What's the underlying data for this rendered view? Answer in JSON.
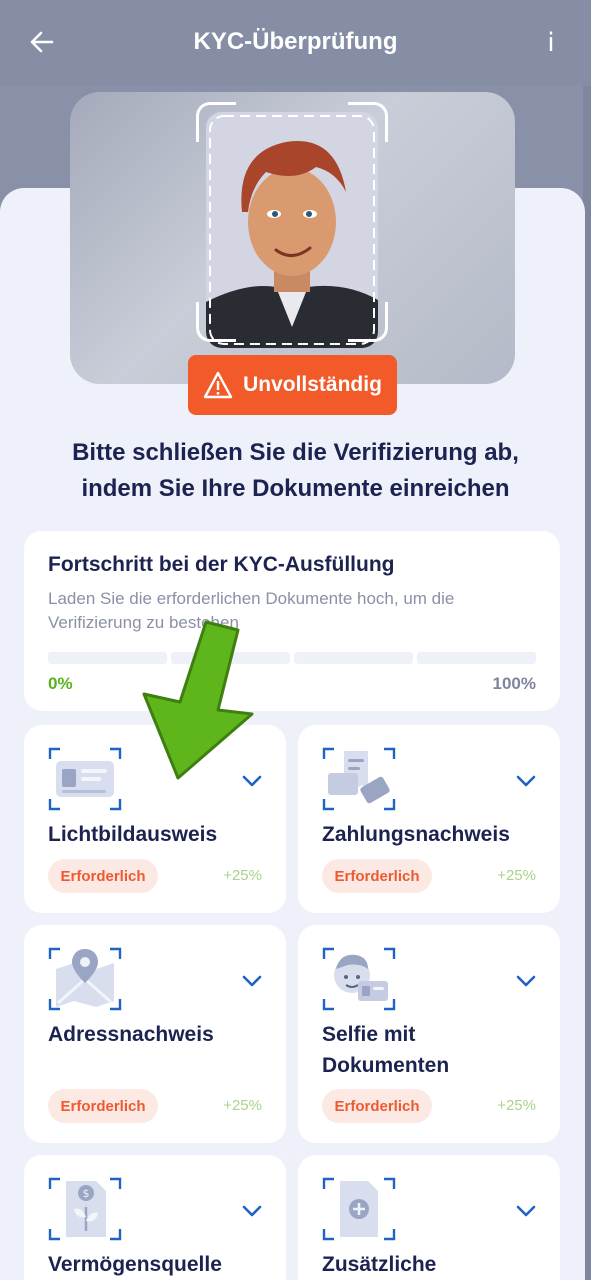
{
  "header": {
    "title": "KYC-Überprüfung",
    "info_label": "i"
  },
  "status": {
    "label": "Unvollständig",
    "color": "#f25a2a"
  },
  "headline": {
    "line1": "Bitte schließen Sie die Verifizierung ab,",
    "line2": "indem Sie Ihre Dokumente einreichen"
  },
  "progress": {
    "title": "Fortschritt bei der KYC-Ausfüllung",
    "subtitle": "Laden Sie die erforderlichen Dokumente hoch, um die Verifizierung zu bestehen",
    "min_label": "0%",
    "max_label": "100%",
    "value": 0
  },
  "documents": [
    {
      "title": "Lichtbildausweis",
      "badge": "Erforderlich",
      "points": "+25%",
      "icon": "id-card-icon"
    },
    {
      "title": "Zahlungsnachweis",
      "badge": "Erforderlich",
      "points": "+25%",
      "icon": "payment-proof-icon"
    },
    {
      "title": "Adressnachweis",
      "badge": "Erforderlich",
      "points": "+25%",
      "icon": "map-pin-icon"
    },
    {
      "title": "Selfie mit Dokumenten",
      "badge": "Erforderlich",
      "points": "+25%",
      "icon": "selfie-icon"
    },
    {
      "title": "Vermögensquelle",
      "badge": "",
      "points": "",
      "icon": "money-plant-icon"
    },
    {
      "title": "Zusätzliche",
      "badge": "",
      "points": "",
      "icon": "add-document-icon"
    }
  ],
  "colors": {
    "accent": "#f25a2a",
    "brand_blue": "#1f63c4",
    "title_text": "#1d2350",
    "success": "#58b31a",
    "arrow": "#5fb61c"
  }
}
